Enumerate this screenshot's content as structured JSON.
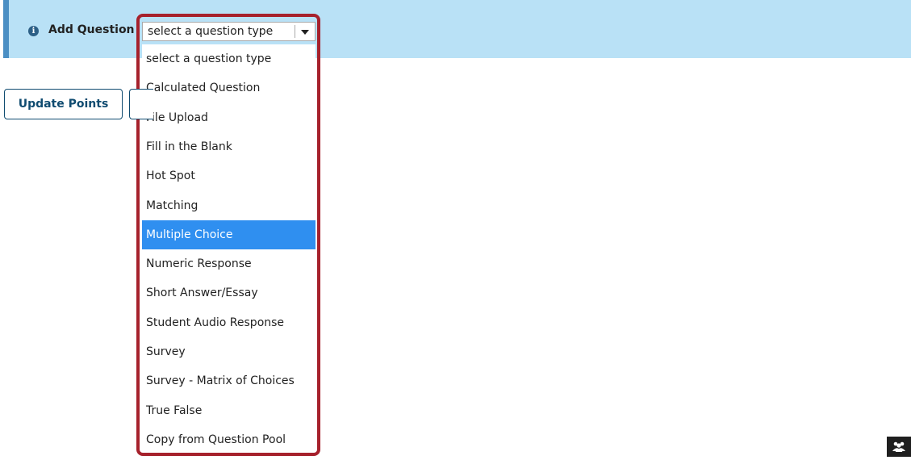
{
  "add_question": {
    "label": "Add Question",
    "info_icon": "info-circle-icon"
  },
  "question_type_select": {
    "selected_value": "select a question type",
    "caret_icon": "caret-down-icon",
    "options": [
      "select a question type",
      "Calculated Question",
      "File Upload",
      "Fill in the Blank",
      "Hot Spot",
      "Matching",
      "Multiple Choice",
      "Numeric Response",
      "Short Answer/Essay",
      "Student Audio Response",
      "Survey",
      "Survey - Matrix of Choices",
      "True False",
      "Copy from Question Pool"
    ],
    "highlighted_option": "Multiple Choice"
  },
  "toolbar": {
    "update_points_label": "Update Points"
  },
  "colors": {
    "bar_background": "#b9e1f6",
    "bar_accent": "#4b8fc4",
    "highlight_frame": "#a6212c",
    "selected_option": "#2f8ff0",
    "button_text": "#0f4b70"
  },
  "corner_widget": {
    "icon": "people-group-icon"
  }
}
